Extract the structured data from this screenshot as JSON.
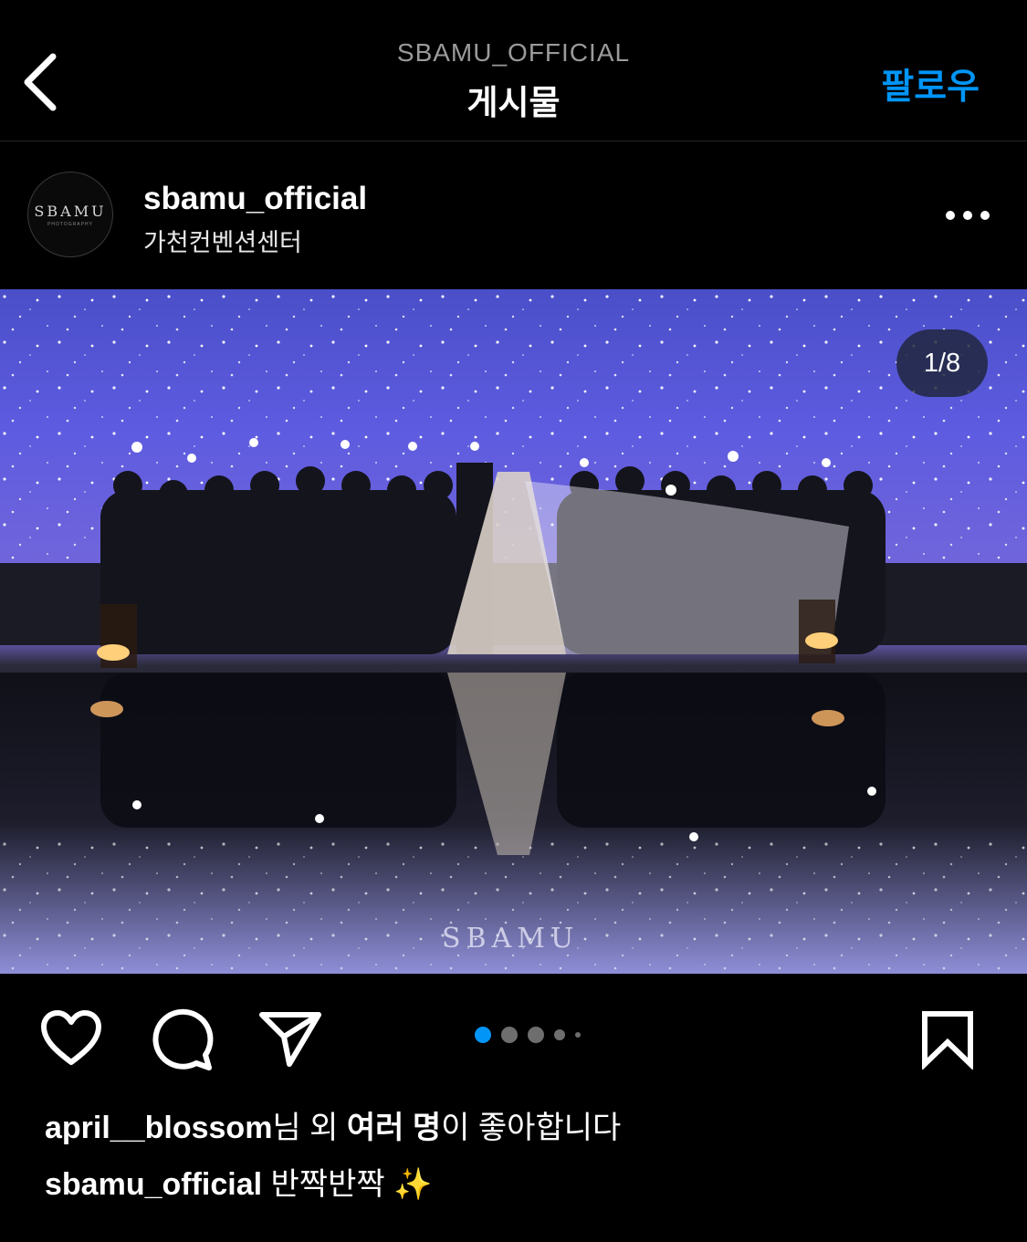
{
  "header": {
    "account": "SBAMU_OFFICIAL",
    "title": "게시물",
    "follow_label": "팔로우"
  },
  "post": {
    "avatar_text": "SBAMU",
    "avatar_subtext": "PHOTOGRAPHY",
    "username": "sbamu_official",
    "location": "가천컨벤션센터",
    "image_counter": "1/8",
    "watermark": "SBAMU",
    "carousel": {
      "current": 1,
      "total": 8,
      "visible_dots": 5
    }
  },
  "likes": {
    "user": "april__blossom",
    "suffix1": "님 외 ",
    "others": "여러 명",
    "suffix2": "이 좋아합니다"
  },
  "caption": {
    "username": "sbamu_official",
    "text": "반짝반짝 ✨"
  },
  "colors": {
    "accent": "#0095f6",
    "background": "#000000",
    "muted_text": "#9a9a9a"
  },
  "icons": [
    "back-arrow-icon",
    "more-icon",
    "heart-icon",
    "comment-icon",
    "share-icon",
    "bookmark-icon"
  ]
}
